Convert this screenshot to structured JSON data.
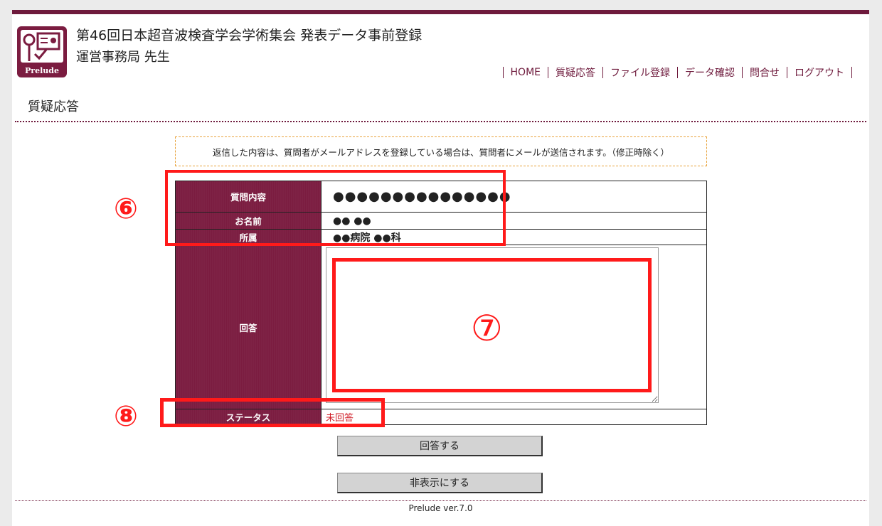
{
  "header": {
    "title": "第46回日本超音波検査学会学術集会 発表データ事前登録",
    "user": "運営事務局 先生",
    "logo_text": "Prelude"
  },
  "nav": [
    {
      "label": "HOME"
    },
    {
      "label": "質疑応答"
    },
    {
      "label": "ファイル登録"
    },
    {
      "label": "データ確認"
    },
    {
      "label": "問合せ"
    },
    {
      "label": "ログアウト"
    }
  ],
  "page_heading": "質疑応答",
  "notice": "返信した内容は、質問者がメールアドレスを登録している場合は、質問者にメールが送信されます。（修正時除く）",
  "form": {
    "question_label": "質問内容",
    "question_value": "●●●●●●●●●●●●●●●",
    "name_label": "お名前",
    "name_value": "●●  ●●",
    "affiliation_label": "所属",
    "affiliation_value": "●●病院  ●●科",
    "answer_label": "回答",
    "answer_value": "",
    "status_label": "ステータス",
    "status_value": "未回答"
  },
  "buttons": {
    "reply": "回答する",
    "hide": "非表示にする"
  },
  "footer": "Prelude ver.7.0",
  "annotations": {
    "m6": "⑥",
    "m7": "⑦",
    "m8": "⑧"
  },
  "colors": {
    "brand": "#7b1c40",
    "annotation": "#ff1a1a",
    "status": "#d0202a",
    "notice_border": "#e8a23a"
  }
}
